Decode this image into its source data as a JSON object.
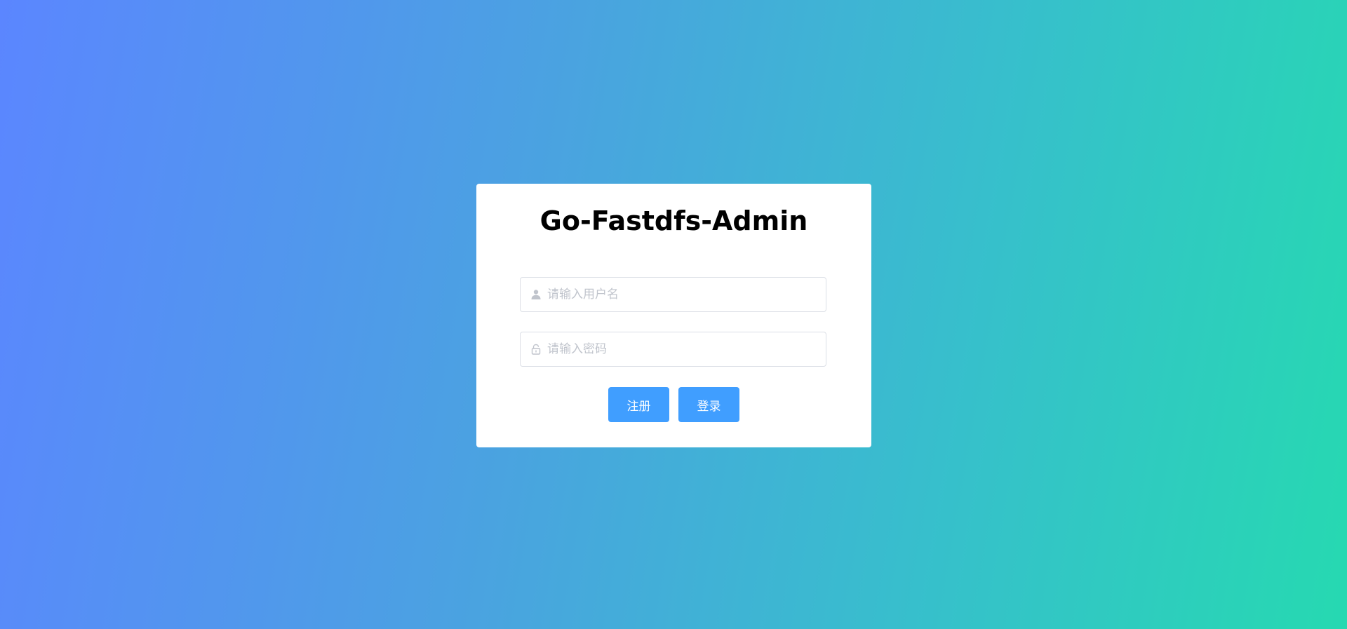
{
  "login_form": {
    "title": "Go-Fastdfs-Admin",
    "username": {
      "value": "",
      "placeholder": "请输入用户名",
      "icon": "user-icon"
    },
    "password": {
      "value": "",
      "placeholder": "请输入密码",
      "icon": "lock-icon"
    },
    "register_label": "注册",
    "login_label": "登录"
  },
  "colors": {
    "background_gradient_start": "#5b86ff",
    "background_gradient_end": "#26d9b1",
    "button_primary": "#409eff",
    "placeholder": "#c0c4cc",
    "input_border": "#dcdfe6"
  }
}
